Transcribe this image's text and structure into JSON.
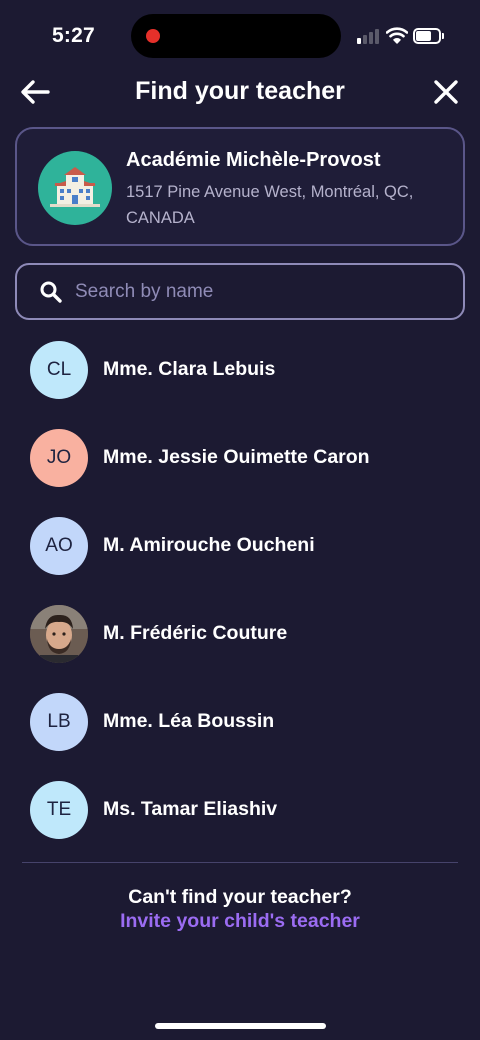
{
  "status_bar": {
    "time": "5:27",
    "signal_bars_active": 1,
    "battery_level": 0.7
  },
  "header": {
    "title": "Find your teacher",
    "back_icon": "arrow-left-icon",
    "close_icon": "close-icon"
  },
  "school": {
    "name": "Académie Michèle-Provost",
    "address": "1517 Pine Avenue West, Montréal, QC, CANADA",
    "icon": "school-building-icon"
  },
  "search": {
    "placeholder": "Search by name",
    "value": "",
    "icon": "search-icon"
  },
  "teachers": [
    {
      "initials": "CL",
      "name": "Mme. Clara Lebuis",
      "avatar_color": "#bfe8fb"
    },
    {
      "initials": "JO",
      "name": "Mme. Jessie Ouimette Caron",
      "avatar_color": "#f9b1a0"
    },
    {
      "initials": "AO",
      "name": "M. Amirouche Oucheni",
      "avatar_color": "#c2d7fa"
    },
    {
      "initials": "",
      "name": "M. Frédéric Couture",
      "avatar_color": "#5a4a42",
      "photo": true
    },
    {
      "initials": "LB",
      "name": "Mme. Léa Boussin",
      "avatar_color": "#c2d7fa"
    },
    {
      "initials": "TE",
      "name": "Ms. Tamar Eliashiv",
      "avatar_color": "#bfe8fb"
    }
  ],
  "footer": {
    "question": "Can't find your teacher?",
    "invite_label": "Invite your child's teacher"
  },
  "colors": {
    "background": "#1c1a32",
    "accent": "#9b6cf2",
    "card_border": "#5a5689",
    "search_border": "#8e8ab8"
  }
}
